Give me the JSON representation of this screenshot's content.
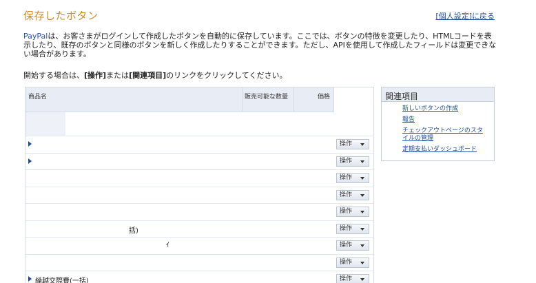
{
  "page": {
    "title": "保存したボタン",
    "top_link": "[個人設定]に戻る"
  },
  "intro": {
    "brand": "PayPal",
    "text": "は、お客さまがログインして作成したボタンを自動的に保存しています。ここでは、ボタンの特徴を変更したり、HTMLコードを表示したり、既存のボタンと同様のボタンを新しく作成したりすることができます。ただし、APIを使用して作成したフィールドは変更できない場合があります。",
    "instruction_pre": "開始する場合は、",
    "instruction_op": "[操作]",
    "instruction_mid": "または",
    "instruction_rel": "[関連項目]",
    "instruction_post": "のリンクをクリックしてください。"
  },
  "table": {
    "headers": {
      "name": "商品名",
      "qty": "販売可能な数量",
      "price": "価格"
    },
    "rows": [
      {
        "name": ""
      },
      {
        "name": ""
      },
      {
        "name": ""
      },
      {
        "name": ""
      },
      {
        "name": ""
      },
      {
        "name": "括)"
      },
      {
        "name": "ｲ"
      },
      {
        "name": ""
      },
      {
        "name": "繰越交際費(一括)"
      }
    ],
    "action_label": "操作"
  },
  "related": {
    "title": "関連項目",
    "items": [
      {
        "label": "新しいボタンの作成"
      },
      {
        "label": "報告"
      },
      {
        "label": "チェックアウトページのスタイルの管理"
      },
      {
        "label": "定期支払いダッシュボード"
      }
    ]
  },
  "colors": {
    "title": "#d28a2e",
    "link": "#1f4f9c",
    "header_bg": "#e8edf5"
  }
}
